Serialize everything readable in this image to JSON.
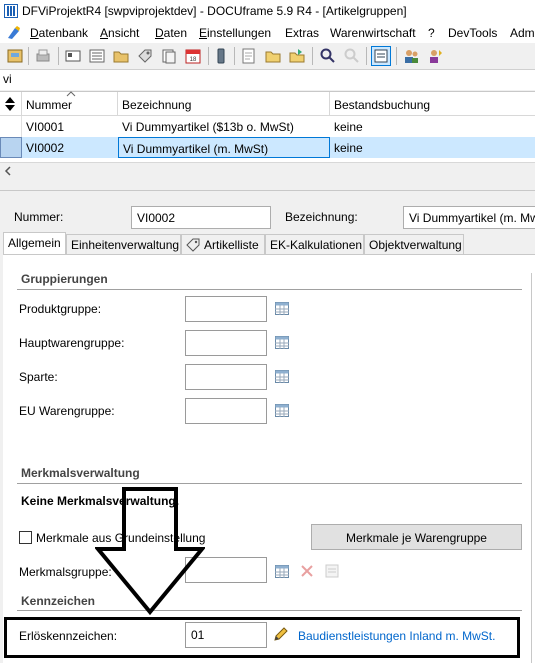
{
  "window": {
    "title": "DFViProjektR4 [swpviprojektdev] - DOCUframe 5.9 R4 - [Artikelgruppen]"
  },
  "menu": [
    {
      "label": "Datenbank",
      "u": "D",
      "rest": "atenbank"
    },
    {
      "label": "Ansicht",
      "u": "A",
      "rest": "nsicht"
    },
    {
      "label": "Daten",
      "u": "D",
      "rest": "aten"
    },
    {
      "label": "Einstellungen",
      "u": "E",
      "rest": "instellungen"
    },
    {
      "label": "Extras",
      "u": "",
      "rest": "Extras"
    },
    {
      "label": "Warenwirtschaft",
      "u": "",
      "rest": "Warenwirtschaft"
    },
    {
      "label": "?",
      "u": "",
      "rest": "?"
    },
    {
      "label": "DevTools",
      "u": "",
      "rest": "DevTools"
    },
    {
      "label": "Adm",
      "u": "",
      "rest": "Adm"
    }
  ],
  "filter": {
    "value": "vi"
  },
  "grid": {
    "columns": [
      "Nummer",
      "Bezeichnung",
      "Bestandsbuchung"
    ],
    "rows": [
      {
        "nummer": "VI0001",
        "bezeichnung": "Vi Dummyartikel ($13b o. MwSt)",
        "bestand": "keine"
      },
      {
        "nummer": "VI0002",
        "bezeichnung": "Vi Dummyartikel (m. MwSt)",
        "bestand": "keine"
      }
    ]
  },
  "header": {
    "nummer_label": "Nummer:",
    "nummer_value": "VI0002",
    "bezeichnung_label": "Bezeichnung:",
    "bezeichnung_value": "Vi Dummyartikel (m. MwSt)"
  },
  "tabs": [
    "Allgemein",
    "Einheitenverwaltung",
    "Artikelliste",
    "EK-Kalkulationen",
    "Objektverwaltung"
  ],
  "gruppierungen": {
    "title": "Gruppierungen",
    "fields": [
      {
        "label": "Produktgruppe:",
        "value": ""
      },
      {
        "label": "Hauptwarengruppe:",
        "value": ""
      },
      {
        "label": "Sparte:",
        "value": ""
      },
      {
        "label": "EU Warengruppe:",
        "value": ""
      }
    ]
  },
  "merkmal": {
    "title": "Merkmalsverwaltung",
    "info": "Keine Merkmalsverwaltung.",
    "checkbox_label": "Merkmale aus Grundeinstellung",
    "button_label": "Merkmale je Warengruppe",
    "gruppe_label": "Merkmalsgruppe:",
    "gruppe_value": ""
  },
  "kennzeichen": {
    "title": "Kennzeichen",
    "erloes_label": "Erlöskennzeichen:",
    "erloes_value": "01",
    "erloes_link": "Baudienstleistungen Inland m. MwSt."
  },
  "colors": {
    "selection": "#cce8ff",
    "selection_border": "#0078d7",
    "link": "#0066cc"
  }
}
